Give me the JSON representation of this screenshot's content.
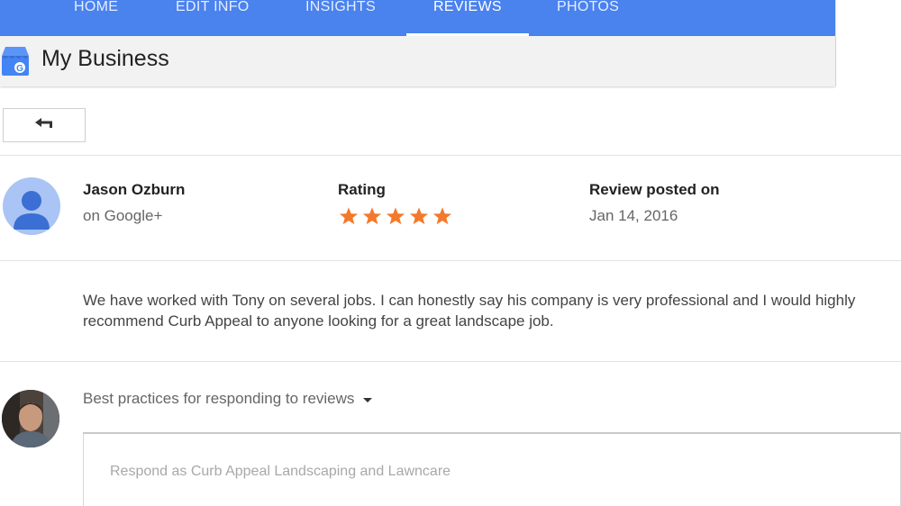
{
  "nav": {
    "tabs": [
      {
        "label": "HOME"
      },
      {
        "label": "EDIT INFO"
      },
      {
        "label": "INSIGHTS"
      },
      {
        "label": "REVIEWS",
        "active": true
      },
      {
        "label": "PHOTOS"
      }
    ],
    "accent_color": "#4a82ee"
  },
  "brand": {
    "title": "My Business",
    "logo_icon": "google-my-business-icon"
  },
  "back_button": {
    "icon": "back-arrow-icon"
  },
  "review": {
    "reviewer_name": "Jason Ozburn",
    "reviewer_source": "on Google+",
    "rating_label": "Rating",
    "rating_stars": 5,
    "rating_max": 5,
    "star_color": "#f4792b",
    "posted_label": "Review posted on",
    "posted_date": "Jan 14, 2016",
    "text": "We have worked with Tony on several jobs. I can honestly say his company is very professional and I would highly recommend Curb Appeal to anyone looking for a great landscape job."
  },
  "reply": {
    "best_practices_label": "Best practices for responding to reviews",
    "placeholder": "Respond as Curb Appeal Landscaping and Lawncare"
  }
}
